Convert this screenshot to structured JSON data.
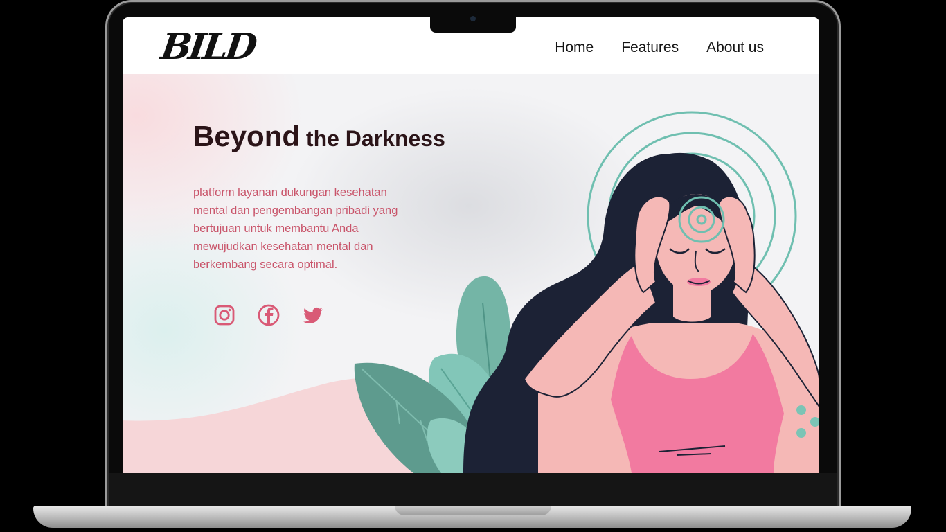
{
  "site": {
    "logo_text": "BILD",
    "nav": {
      "home": "Home",
      "features": "Features",
      "about": "About us"
    }
  },
  "hero": {
    "title_main": "Beyond",
    "title_rest": "the Darkness",
    "description": "platform layanan dukungan kesehatan mental dan pengembangan pribadi yang bertujuan untuk membantu Anda mewujudkan kesehatan mental dan berkembang secara optimal."
  },
  "social_icons": [
    "instagram-icon",
    "facebook-icon",
    "twitter-icon"
  ],
  "colors": {
    "accent_pink": "#d95a76",
    "text_dark": "#2b1418",
    "teal": "#6fbfb0",
    "hair_navy": "#1c2235",
    "top_pink": "#f27aa0"
  }
}
